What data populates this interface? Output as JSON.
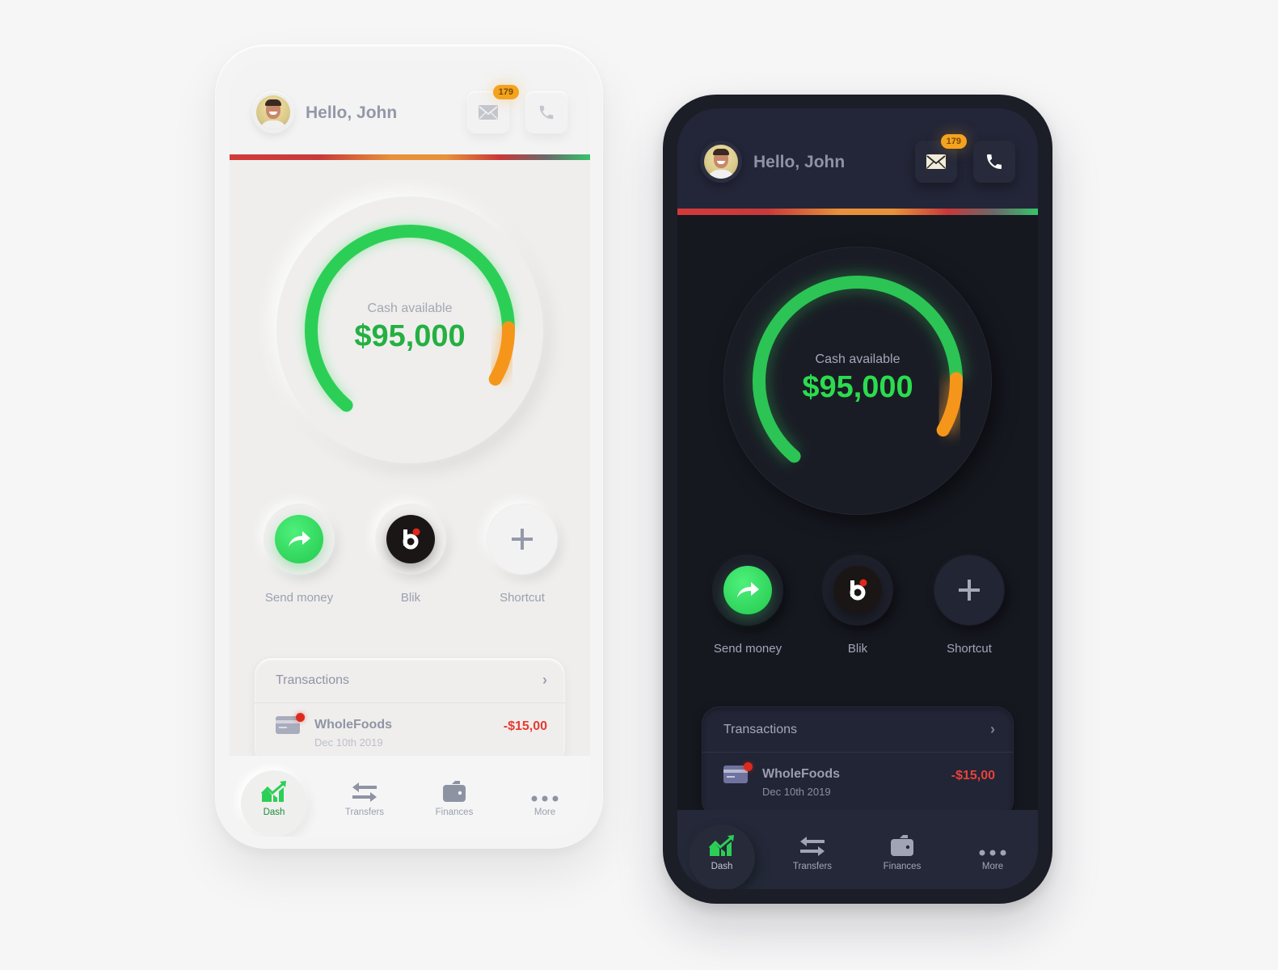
{
  "phones": {
    "light": {
      "theme": "light",
      "header": {
        "greeting": "Hello, John",
        "mail_badge": "179"
      },
      "balance": {
        "label": "Cash available",
        "value": "$95,000",
        "gauge_fraction_green": 0.88,
        "gauge_fraction_orange": 0.12
      },
      "shortcuts": [
        {
          "label": "Send money",
          "icon": "share-arrow-icon"
        },
        {
          "label": "Blik",
          "icon": "blik-logo-icon"
        },
        {
          "label": "Shortcut",
          "icon": "plus-icon"
        }
      ],
      "transactions": {
        "title": "Transactions",
        "items": [
          {
            "merchant": "WholeFoods",
            "date": "Dec 10th  2019",
            "amount": "-$15,00"
          }
        ]
      },
      "nav": [
        {
          "label": "Dash",
          "icon": "chart-trend-icon",
          "active": true
        },
        {
          "label": "Transfers",
          "icon": "transfer-arrows-icon"
        },
        {
          "label": "Finances",
          "icon": "wallet-icon"
        },
        {
          "label": "More",
          "icon": "more-dots-icon"
        }
      ]
    },
    "dark": {
      "theme": "dark",
      "header": {
        "greeting": "Hello, John",
        "mail_badge": "179"
      },
      "balance": {
        "label": "Cash available",
        "value": "$95,000",
        "gauge_fraction_green": 0.88,
        "gauge_fraction_orange": 0.12
      },
      "shortcuts": [
        {
          "label": "Send money",
          "icon": "share-arrow-icon"
        },
        {
          "label": "Blik",
          "icon": "blik-logo-icon"
        },
        {
          "label": "Shortcut",
          "icon": "plus-icon"
        }
      ],
      "transactions": {
        "title": "Transactions",
        "items": [
          {
            "merchant": "WholeFoods",
            "date": "Dec 10th  2019",
            "amount": "-$15,00"
          }
        ]
      },
      "nav": [
        {
          "label": "Dash",
          "icon": "chart-trend-icon",
          "active": true
        },
        {
          "label": "Transfers",
          "icon": "transfer-arrows-icon"
        },
        {
          "label": "Finances",
          "icon": "wallet-icon"
        },
        {
          "label": "More",
          "icon": "more-dots-icon"
        }
      ]
    }
  },
  "colors": {
    "accent_green": "#24b042",
    "accent_green_bright": "#2bdc4e",
    "warning_orange": "#f5961a",
    "badge_orange": "#f4a31f",
    "negative_red": "#e63b30",
    "dark_bg": "#1b1d27",
    "light_bg": "#f4f4f4"
  }
}
